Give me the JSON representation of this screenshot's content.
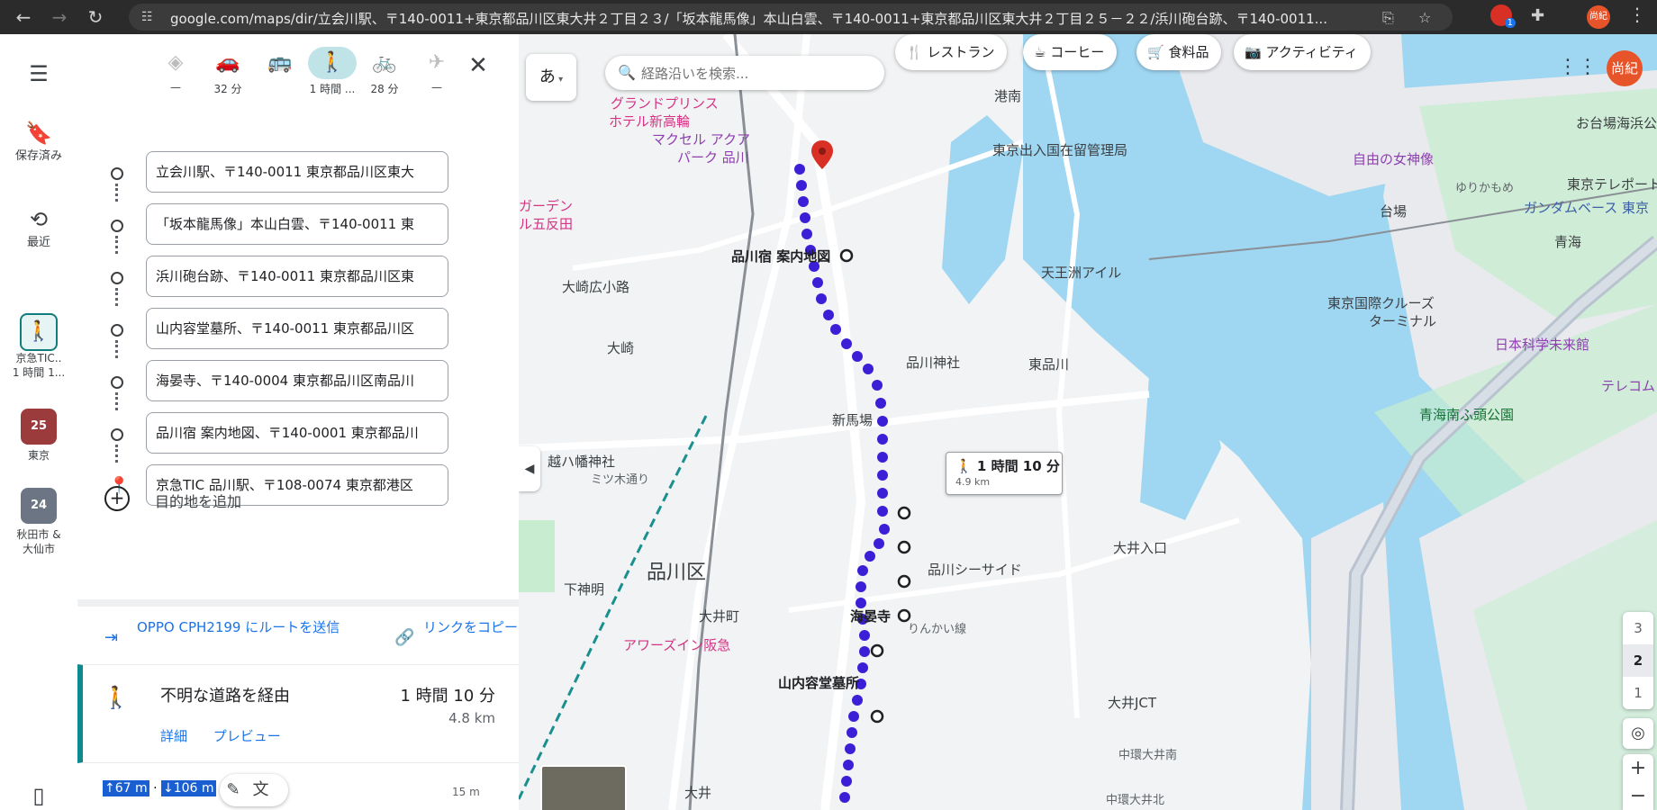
{
  "browser": {
    "url": "google.com/maps/dir/立会川駅、〒140-0011+東京都品川区東大井２丁目２３/「坂本龍馬像」本山白雲、〒140-0011+東京都品川区東大井２丁目２５－２２/浜川砲台跡、〒140-0011...",
    "back_icon": "arrow-left-icon",
    "profile_label": "尚紀",
    "extension_badge_count": "1"
  },
  "rail": {
    "menu_icon": "menu-icon",
    "saved_label": "保存済み",
    "recent_label": "最近",
    "recent_trip": {
      "line1": "京急TIC..",
      "line2": "1 時間 1..."
    },
    "tokyo": {
      "badge": "25",
      "label": "東京"
    },
    "akita": {
      "badge": "24",
      "label_line1": "秋田市 &",
      "label_line2": "大仙市"
    }
  },
  "modes": [
    {
      "name": "best",
      "icon": "◈",
      "label": "—"
    },
    {
      "name": "drive",
      "icon": "🚗",
      "label": "32 分"
    },
    {
      "name": "transit",
      "icon": "🚌",
      "label": ""
    },
    {
      "name": "walk",
      "icon": "🚶",
      "label": "1 時間 ..."
    },
    {
      "name": "bike",
      "icon": "🚲",
      "label": "28 分"
    },
    {
      "name": "flight",
      "icon": "✈",
      "label": "—"
    }
  ],
  "waypoints": [
    "立会川駅、〒140-0011 東京都品川区東大",
    "「坂本龍馬像」本山白雲、〒140-0011 東",
    "浜川砲台跡、〒140-0011 東京都品川区東",
    "山内容堂墓所、〒140-0011 東京都品川区",
    "海晏寺、〒140-0004 東京都品川区南品川",
    "品川宿 案内地図、〒140-0001 東京都品川",
    "京急TIC 品川駅、〒108-0074 東京都港区"
  ],
  "add_destination": "目的地を追加",
  "send_to_phone": "OPPO CPH2199 にルートを送信",
  "copy_link": "リンクをコピー",
  "route": {
    "via": "不明な道路を経由",
    "time": "1 時間 10 分",
    "distance": "4.8 km",
    "details": "詳細",
    "preview": "プレビュー"
  },
  "elevation": {
    "up": "↑67 m",
    "down": "↓106 m",
    "scale": "15 m"
  },
  "map": {
    "ime": "あ",
    "search_placeholder": "経路沿いを検索...",
    "chips": [
      "レストラン",
      "コーヒー",
      "食料品",
      "アクティビティ"
    ],
    "eta_title": "1 時間 10 分",
    "eta_distance": "4.9 km",
    "avatar": "尚紀",
    "floors": [
      "3",
      "2",
      "1"
    ],
    "labels": {
      "shinagawa_ku": "品川区",
      "grand_prince": "グランドプリンス",
      "grand_prince_2": "ホテル新高輪",
      "maxell": "マクセル アクア",
      "maxell_2": "パーク 品川",
      "kanai_chizu": "品川宿 案内地図",
      "shinagawa_jinja": "品川神社",
      "shinbaba": "新馬場",
      "seaside": "品川シーサイド",
      "kaianji": "海晏寺",
      "yamauchi": "山内容堂墓所",
      "oimachi": "大井町",
      "shimoshinmei": "下神明",
      "osaki": "大崎",
      "osaki_hiroshima": "大崎広小路",
      "koshi_hachiman": "越ハ幡神社",
      "sanbi": "ミツ木通り",
      "awazu": "アワーズイン阪急",
      "rinkai": "りんかい線",
      "tennozu": "天王洲アイル",
      "nyukoku": "東京出入国在留管理局",
      "higashi_shinagawa": "東品川",
      "konan": "港南",
      "jiyu": "自由の女神像",
      "daiba": "台場",
      "telecom": "東京テレポート",
      "gundam": "ガンダムベース 東京",
      "aomi": "青海",
      "cruise": "東京国際クルーズ",
      "cruise2": "ターミナル",
      "miraikan": "日本科学未来館",
      "aomi_park": "青海南ふ頭公園",
      "oi_iriguchi": "大井入口",
      "oi_jct": "大井JCT",
      "odaiba_kaihin": "お台場海浜公園",
      "yurikamome": "ゆりかもめ",
      "garden": "ガーデン",
      "gotanda": "ル五反田",
      "oi": "大井",
      "tenno": "天王",
      "teleco": "テレコム",
      "chuwan": "中環大井南",
      "chuwan2": "中環大井北"
    }
  },
  "colors": {
    "route": "#3b1fd6",
    "accent_teal": "#0e8a8f",
    "water": "#9fd6f1",
    "park": "#c8ecd0",
    "link": "#1a73e8"
  }
}
